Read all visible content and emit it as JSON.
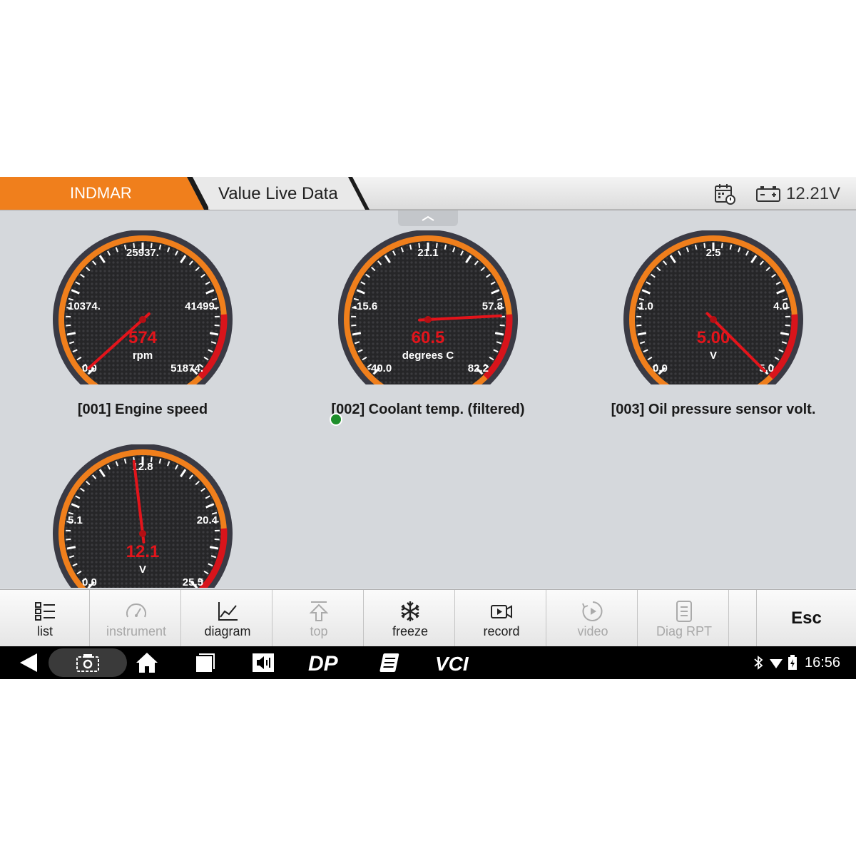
{
  "header": {
    "brand": "INDMAR",
    "title": "Value Live Data",
    "battery_voltage": "12.21V",
    "icons": [
      "calendar-icon",
      "battery-icon"
    ]
  },
  "gauges": [
    {
      "id": "gauge-001",
      "caption": "[001] Engine speed",
      "unit": "rpm",
      "value_text": "574",
      "value": 574,
      "ticks": [
        "0.0",
        "10374.",
        "25937.",
        "41499.",
        "51874."
      ],
      "min": 0.0,
      "max": 51874
    },
    {
      "id": "gauge-002",
      "caption": "[002] Coolant temp. (filtered)",
      "unit": "degrees C",
      "value_text": "60.5",
      "value": 60.5,
      "ticks": [
        "-40.0",
        "-15.6",
        "21.1",
        "57.8",
        "82.2"
      ],
      "min": -40.0,
      "max": 82.2
    },
    {
      "id": "gauge-003",
      "caption": "[003] Oil pressure sensor volt.",
      "unit": "V",
      "value_text": "5.00",
      "value": 5.0,
      "ticks": [
        "0.0",
        "1.0",
        "2.5",
        "4.0",
        "5.0"
      ],
      "min": 0.0,
      "max": 5.0
    },
    {
      "id": "gauge-004",
      "caption": "",
      "unit": "V",
      "value_text": "12.1",
      "value": 12.1,
      "ticks": [
        "0.0",
        "5.1",
        "12.8",
        "20.4",
        "25.5"
      ],
      "min": 0.0,
      "max": 25.5
    }
  ],
  "toolbar": {
    "buttons": [
      {
        "label": "list",
        "icon": "list-icon",
        "enabled": true
      },
      {
        "label": "instrument",
        "icon": "instrument-icon",
        "enabled": false
      },
      {
        "label": "diagram",
        "icon": "diagram-icon",
        "enabled": true
      },
      {
        "label": "top",
        "icon": "top-arrow-icon",
        "enabled": false
      },
      {
        "label": "freeze",
        "icon": "snowflake-icon",
        "enabled": true
      },
      {
        "label": "record",
        "icon": "record-icon",
        "enabled": true
      },
      {
        "label": "video",
        "icon": "video-icon",
        "enabled": false
      },
      {
        "label": "Diag RPT",
        "icon": "report-icon",
        "enabled": false
      }
    ],
    "esc_label": "Esc"
  },
  "navbar": {
    "time": "16:56",
    "icons": [
      "back-icon",
      "screenshot-icon",
      "home-icon",
      "recent-apps-icon",
      "volume-icon",
      "dp-icon",
      "notes-icon",
      "vci-icon",
      "bluetooth-icon",
      "wifi-icon",
      "battery-status-icon"
    ],
    "dp_label": "DP",
    "vci_label": "VCI"
  },
  "colors": {
    "accent": "#f07f1c",
    "gauge_value": "#e3141b",
    "gauge_face": "#2a2a2c",
    "gauge_rim": "#f07f1c",
    "status_dot": "#1e8e2b"
  }
}
